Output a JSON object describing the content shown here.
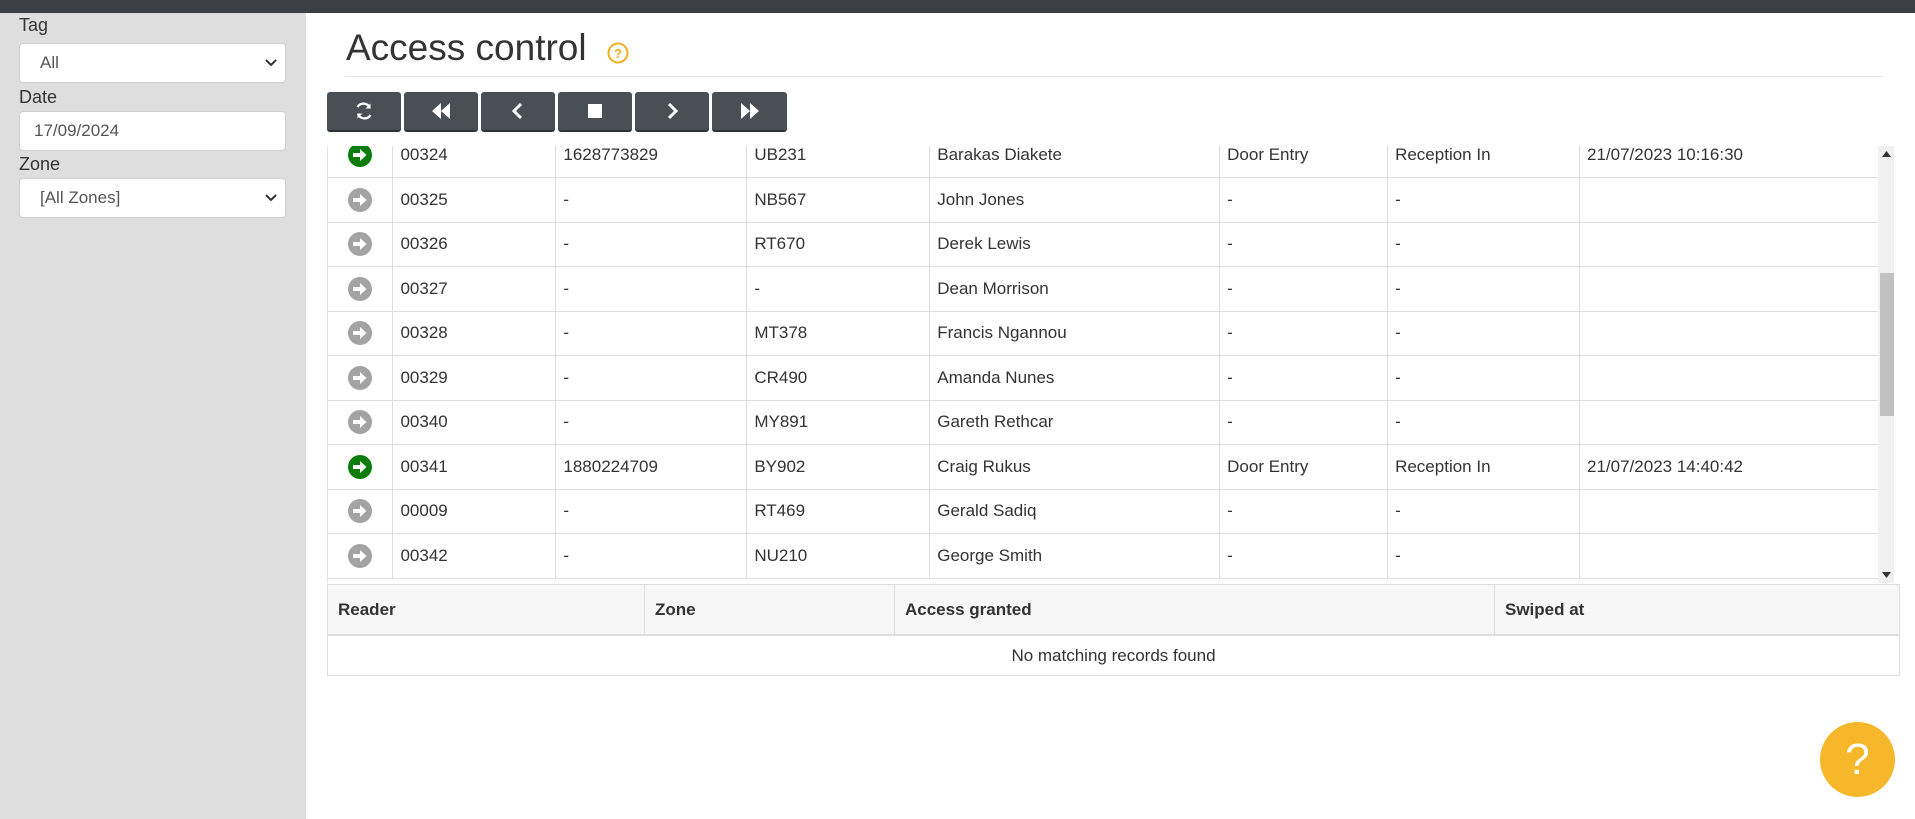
{
  "sidebar": {
    "tag_label": "Tag",
    "tag_value": "All",
    "date_label": "Date",
    "date_value": "17/09/2024",
    "zone_label": "Zone",
    "zone_value": "[All Zones]"
  },
  "page": {
    "title": "Access control",
    "help_icon": "question-circle-icon"
  },
  "toolbar": {
    "buttons": [
      "refresh-icon",
      "fast-backward-icon",
      "step-backward-icon",
      "stop-icon",
      "step-forward-icon",
      "fast-forward-icon"
    ]
  },
  "people": {
    "rows": [
      {
        "status": "green",
        "id": "00324",
        "card": "1628773829",
        "code": "UB231",
        "name": "Barakas Diakete",
        "reader": "Door Entry",
        "zone": "Reception In",
        "time": "21/07/2023 10:16:30"
      },
      {
        "status": "grey",
        "id": "00325",
        "card": "-",
        "code": "NB567",
        "name": "John Jones",
        "reader": "-",
        "zone": "-",
        "time": ""
      },
      {
        "status": "grey",
        "id": "00326",
        "card": "-",
        "code": "RT670",
        "name": "Derek Lewis",
        "reader": "-",
        "zone": "-",
        "time": ""
      },
      {
        "status": "grey",
        "id": "00327",
        "card": "-",
        "code": "-",
        "name": "Dean Morrison",
        "reader": "-",
        "zone": "-",
        "time": ""
      },
      {
        "status": "grey",
        "id": "00328",
        "card": "-",
        "code": "MT378",
        "name": "Francis Ngannou",
        "reader": "-",
        "zone": "-",
        "time": ""
      },
      {
        "status": "grey",
        "id": "00329",
        "card": "-",
        "code": "CR490",
        "name": "Amanda Nunes",
        "reader": "-",
        "zone": "-",
        "time": ""
      },
      {
        "status": "grey",
        "id": "00340",
        "card": "-",
        "code": "MY891",
        "name": "Gareth Rethcar",
        "reader": "-",
        "zone": "-",
        "time": ""
      },
      {
        "status": "green",
        "id": "00341",
        "card": "1880224709",
        "code": "BY902",
        "name": "Craig Rukus",
        "reader": "Door Entry",
        "zone": "Reception In",
        "time": "21/07/2023 14:40:42"
      },
      {
        "status": "grey",
        "id": "00009",
        "card": "-",
        "code": "RT469",
        "name": "Gerald Sadiq",
        "reader": "-",
        "zone": "-",
        "time": ""
      },
      {
        "status": "grey",
        "id": "00342",
        "card": "-",
        "code": "NU210",
        "name": "George Smith",
        "reader": "-",
        "zone": "-",
        "time": ""
      }
    ]
  },
  "access_log": {
    "headers": [
      "Reader",
      "Zone",
      "Access granted",
      "Swiped at"
    ],
    "empty_text": "No matching records found"
  },
  "fab": {
    "label": "?"
  },
  "colors": {
    "status_green": "#0a7d0a",
    "status_grey": "#a3a3a3",
    "accent": "#f6b82a",
    "toolbar": "#4a4f55"
  }
}
